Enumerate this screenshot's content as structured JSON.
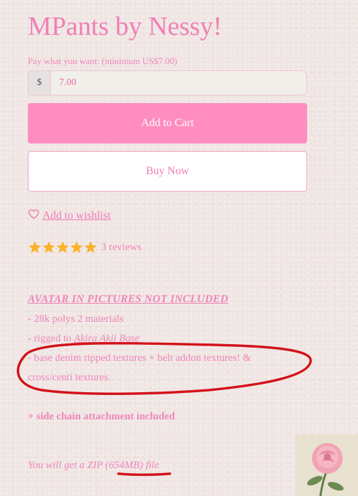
{
  "product": {
    "title": "MPants by Nessy!"
  },
  "pricing": {
    "label": "Pay what you want: (minimum US$7.00)",
    "currency_symbol": "$",
    "value": "7.00"
  },
  "buttons": {
    "add_to_cart": "Add to Cart",
    "buy_now": "Buy Now",
    "wishlist": "Add to wishlist"
  },
  "rating": {
    "stars": 5,
    "reviews_text": "3 reviews"
  },
  "description": {
    "headline": "AVATAR IN PICTURES NOT INCLUDED",
    "polys": "- 28k polys 2 materials",
    "rigged_prefix": "- rigged to ",
    "rigged_link": "Akira Akii Base",
    "textures_line1": "- base denim ripped textures + belt addon textures! &",
    "textures_line2": "cross/centi textures.",
    "side_chain": "+ side chain attachment included",
    "zip_prefix": "You will get a ZIP (",
    "zip_size": "654MB",
    "zip_suffix": ") file"
  },
  "colors": {
    "accent": "#ff8dc0",
    "text": "#ef86b8",
    "star": "#fbb22a",
    "annotation": "#d3121a"
  },
  "icons": {
    "wishlist": "heart-outline-icon",
    "star": "star-icon"
  }
}
